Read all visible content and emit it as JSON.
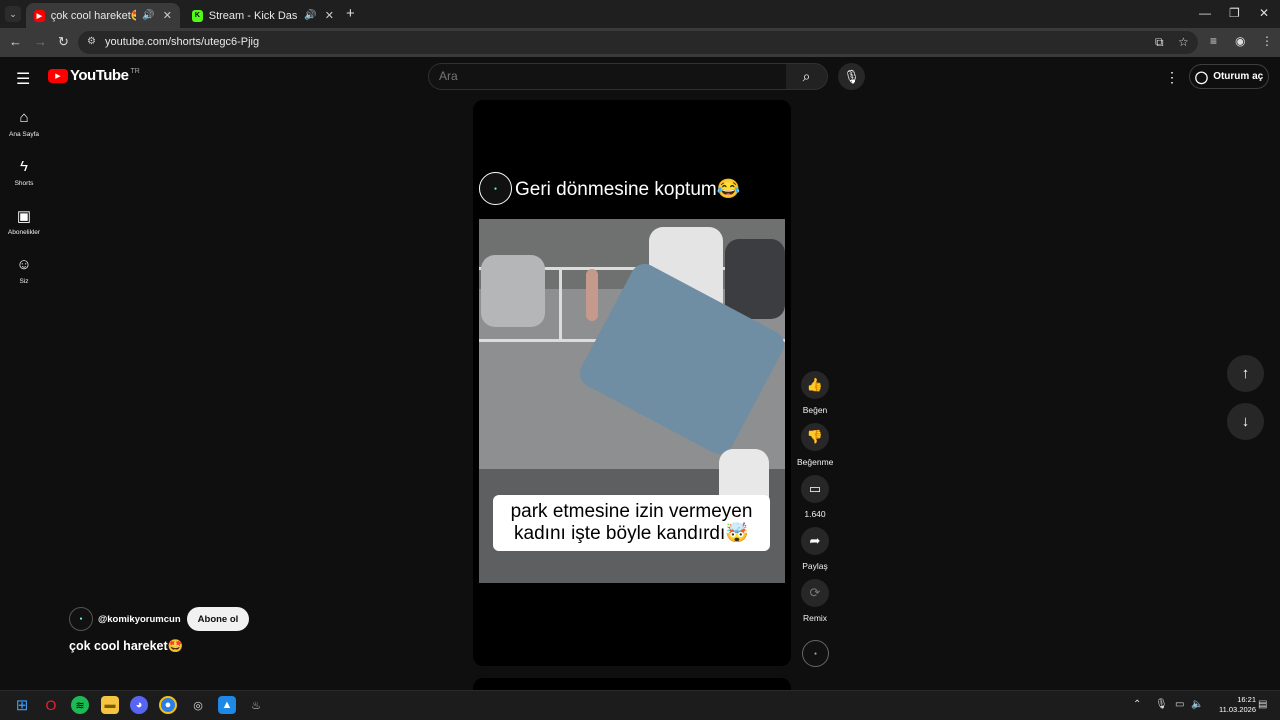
{
  "browser": {
    "tabs": [
      {
        "title": "çok cool hareket🤩 - YouTube",
        "active": true
      },
      {
        "title": "Stream - Kick Dashboard",
        "active": false
      }
    ],
    "url": "youtube.com/shorts/utegc6-Pjig"
  },
  "youtube": {
    "logo_text": "YouTube",
    "country_code": "TR",
    "search_placeholder": "Ara",
    "sign_in_label": "Oturum aç"
  },
  "sidebar": {
    "items": [
      {
        "label": "Ana Sayfa",
        "icon": "home-icon"
      },
      {
        "label": "Shorts",
        "icon": "shorts-icon"
      },
      {
        "label": "Abonelikler",
        "icon": "subscriptions-icon"
      },
      {
        "label": "Siz",
        "icon": "you-icon"
      }
    ]
  },
  "short": {
    "video_caption_top": "Geri dönmesine koptum😂",
    "video_caption_overlay_line1": "park etmesine izin vermeyen",
    "video_caption_overlay_line2": "kadını işte böyle kandırdı🤯",
    "channel_handle": "@komikyorumcun",
    "subscribe_label": "Abone ol",
    "title": "çok cool hareket🤩"
  },
  "actions": {
    "like_label": "Beğen",
    "dislike_label": "Beğenme",
    "comments_count": "1.640",
    "share_label": "Paylaş",
    "remix_label": "Remix"
  },
  "taskbar": {
    "time": "16:21",
    "date": "11.03.2026"
  },
  "colors": {
    "youtube_red": "#ff0000",
    "background": "#0f0f0f",
    "button_bg": "#272727"
  }
}
